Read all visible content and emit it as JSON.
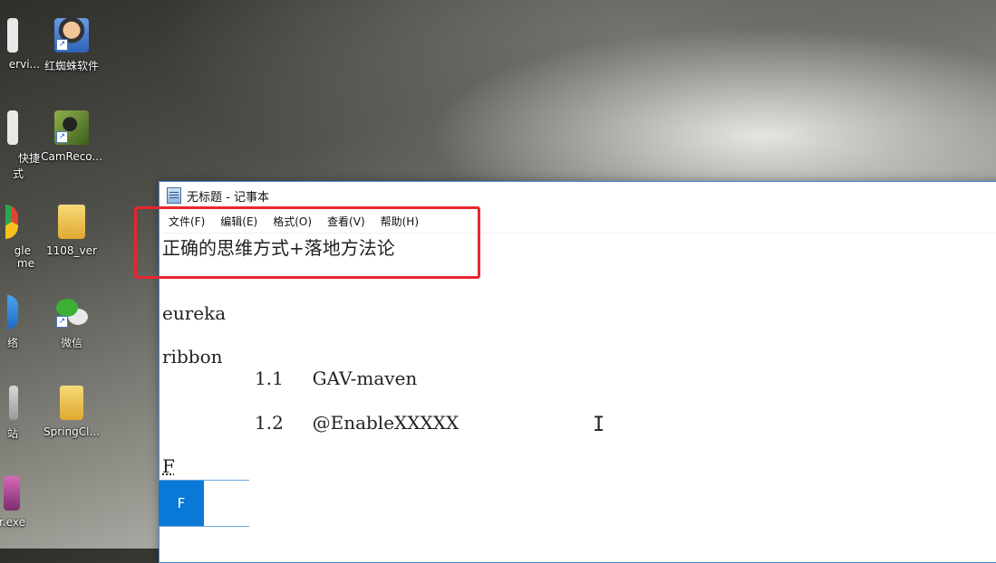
{
  "desktop": {
    "icons": [
      {
        "label": "ervi...",
        "icon": "app-icon-partial"
      },
      {
        "label": "红蜘蛛软件",
        "icon": "red-spider-icon"
      },
      {
        "label": "快捷",
        "icon": "shortcut-icon-partial"
      },
      {
        "label": "式",
        "icon": "shortcut-icon-partial"
      },
      {
        "label": "CamReco...",
        "icon": "camera-recorder-icon"
      },
      {
        "label": "gle",
        "icon": "chrome-icon-partial"
      },
      {
        "label": "me",
        "icon": "chrome-icon-partial"
      },
      {
        "label": "1108_ver",
        "icon": "folder-icon"
      },
      {
        "label": "络",
        "icon": "network-icon-partial"
      },
      {
        "label": "微信",
        "icon": "wechat-icon"
      },
      {
        "label": "站",
        "icon": "recycle-bin-icon-partial"
      },
      {
        "label": "SpringCl...",
        "icon": "folder-icon"
      },
      {
        "label": "r.exe",
        "icon": "exe-icon-partial"
      }
    ]
  },
  "notepad": {
    "title": "无标题 - 记事本",
    "menu": [
      "文件(F)",
      "编辑(E)",
      "格式(O)",
      "查看(V)",
      "帮助(H)"
    ],
    "lines": [
      "正确的思维方式+落地方法论",
      "eureka",
      "ribbon",
      "1.1     GAV-maven",
      "1.2     @EnableXXXXX",
      "F"
    ]
  },
  "ime": {
    "label": "F"
  },
  "colors": {
    "highlight": "#e8262e",
    "ime_accent": "#0a78d6",
    "window_border": "#4d8bd6"
  }
}
